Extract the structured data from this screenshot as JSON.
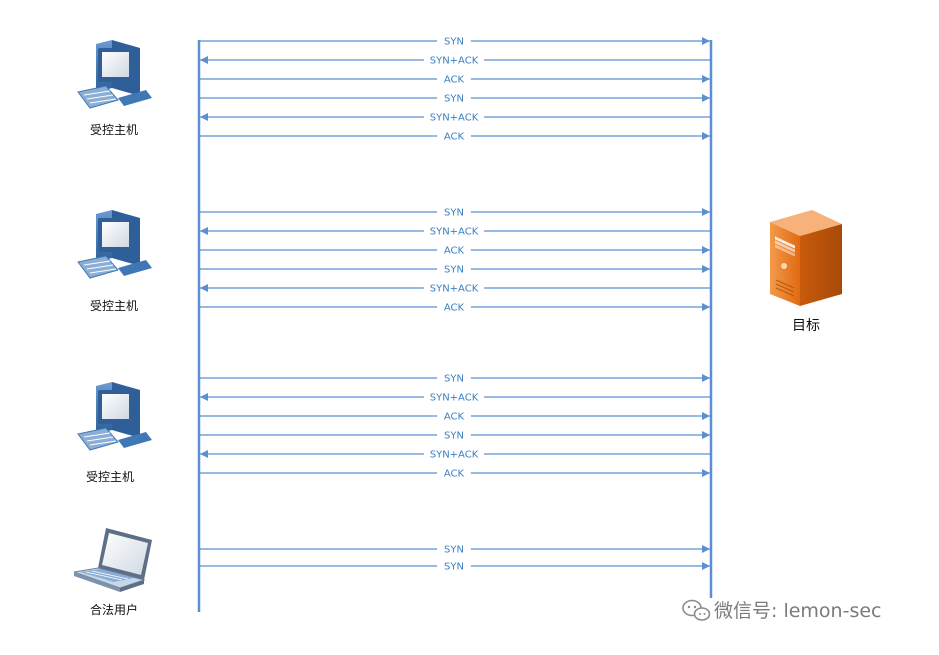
{
  "colors": {
    "arrow": "#5b8fd0",
    "label": "#3a7fc1",
    "server": "#e8731c",
    "monitor": "#3f78b4",
    "watermark": "#7b7b7b"
  },
  "hosts": [
    {
      "label": "受控主机",
      "icon": "desktop-computer-icon"
    },
    {
      "label": "受控主机",
      "icon": "desktop-computer-icon"
    },
    {
      "label": "受控主机",
      "icon": "desktop-computer-icon"
    },
    {
      "label": "合法用户",
      "icon": "laptop-icon"
    }
  ],
  "target": {
    "label": "目标",
    "icon": "server-tower-icon"
  },
  "groups": [
    {
      "messages": [
        {
          "label": "SYN",
          "direction": "to-target"
        },
        {
          "label": "SYN+ACK",
          "direction": "to-host"
        },
        {
          "label": "ACK",
          "direction": "to-target"
        },
        {
          "label": "SYN",
          "direction": "to-target"
        },
        {
          "label": "SYN+ACK",
          "direction": "to-host"
        },
        {
          "label": "ACK",
          "direction": "to-target"
        }
      ]
    },
    {
      "messages": [
        {
          "label": "SYN",
          "direction": "to-target"
        },
        {
          "label": "SYN+ACK",
          "direction": "to-host"
        },
        {
          "label": "ACK",
          "direction": "to-target"
        },
        {
          "label": "SYN",
          "direction": "to-target"
        },
        {
          "label": "SYN+ACK",
          "direction": "to-host"
        },
        {
          "label": "ACK",
          "direction": "to-target"
        }
      ]
    },
    {
      "messages": [
        {
          "label": "SYN",
          "direction": "to-target"
        },
        {
          "label": "SYN+ACK",
          "direction": "to-host"
        },
        {
          "label": "ACK",
          "direction": "to-target"
        },
        {
          "label": "SYN",
          "direction": "to-target"
        },
        {
          "label": "SYN+ACK",
          "direction": "to-host"
        },
        {
          "label": "ACK",
          "direction": "to-target"
        }
      ]
    },
    {
      "messages": [
        {
          "label": "SYN",
          "direction": "to-target"
        },
        {
          "label": "SYN",
          "direction": "to-target"
        }
      ]
    }
  ],
  "watermark": {
    "text": "微信号: lemon-sec",
    "icon": "wechat-icon"
  }
}
